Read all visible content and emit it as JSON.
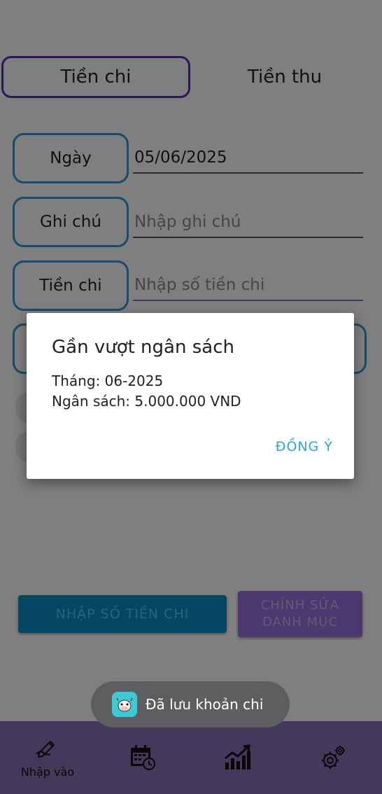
{
  "tabs": [
    {
      "label": "Tiền chi",
      "active": true
    },
    {
      "label": "Tiền thu",
      "active": false
    }
  ],
  "form": {
    "date": {
      "label": "Ngày",
      "value": "05/06/2025"
    },
    "note": {
      "label": "Ghi chú",
      "placeholder": "Nhập ghi chú"
    },
    "amount": {
      "label": "Tiền chi",
      "placeholder": "Nhập số tiền chi"
    }
  },
  "actions": {
    "submit_label": "NHẬP SỐ TIỀN CHI",
    "edit_category_line1": "CHỈNH SỬA",
    "edit_category_line2": "DANH MỤC"
  },
  "dialog": {
    "title": "Gần vượt ngân sách",
    "month_line": "Tháng: 06-2025",
    "budget_line": "Ngân sách: 5.000.000 VND",
    "confirm_label": "ĐỒNG Ý"
  },
  "toast": {
    "text": "Đã lưu khoản chi",
    "icon": "app-cow-icon"
  },
  "bottom_nav": [
    {
      "label": "Nhập vào",
      "icon": "pen-icon"
    },
    {
      "label": "",
      "icon": "calendar-clock-icon"
    },
    {
      "label": "",
      "icon": "chart-icon"
    },
    {
      "label": "",
      "icon": "gear-icon"
    }
  ],
  "colors": {
    "accent_blue": "#2c9ad6",
    "tab_border": "#5b2fb5",
    "nav_background": "#8a72b6",
    "dialog_button": "#2aa6da"
  }
}
